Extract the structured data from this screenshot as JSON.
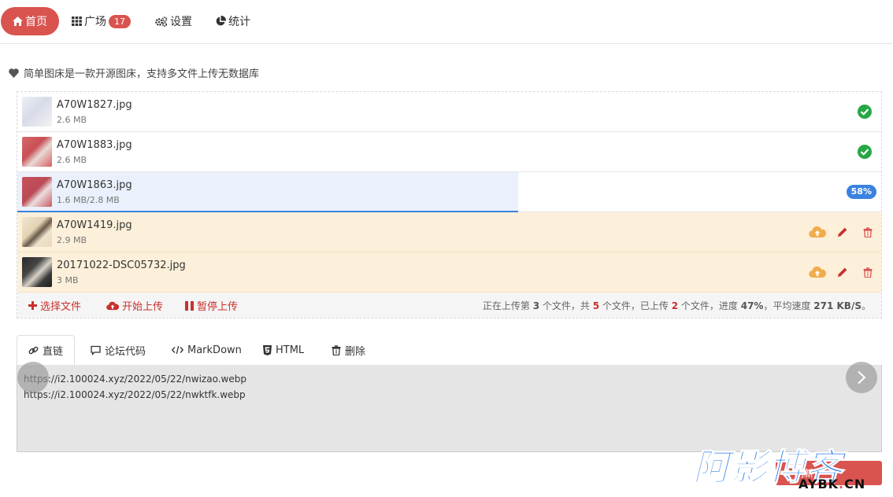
{
  "nav": {
    "home": "首页",
    "square": "广场",
    "square_badge": "17",
    "settings": "设置",
    "stats": "统计"
  },
  "description": "简单图床是一款开源图床，支持多文件上传无数据库",
  "files": [
    {
      "name": "A70W1827.jpg",
      "size": "2.6 MB",
      "state": "done"
    },
    {
      "name": "A70W1883.jpg",
      "size": "2.6 MB",
      "state": "done"
    },
    {
      "name": "A70W1863.jpg",
      "size": "1.6 MB/2.8 MB",
      "state": "uploading",
      "progress_label": "58%",
      "progress": 0.58
    },
    {
      "name": "A70W1419.jpg",
      "size": "2.9 MB",
      "state": "pending"
    },
    {
      "name": "20171022-DSC05732.jpg",
      "size": "3 MB",
      "state": "pending"
    }
  ],
  "toolbar": {
    "select": "选择文件",
    "start": "开始上传",
    "pause": "暂停上传",
    "stats": {
      "p1": "正在上传第 ",
      "current": "3",
      "p2": " 个文件，共 ",
      "total": "5",
      "p3": " 个文件，已上传 ",
      "uploaded": "2",
      "p4": " 个文件，进度 ",
      "percent": "47%",
      "p5": "，平均速度 ",
      "speed": "271 KB/S",
      "p6": "。"
    }
  },
  "tabs": [
    {
      "label": "直链"
    },
    {
      "label": "论坛代码"
    },
    {
      "label": "MarkDown"
    },
    {
      "label": "HTML"
    },
    {
      "label": "删除"
    }
  ],
  "links": [
    "https://i2.100024.xyz/2022/05/22/nwizao.webp",
    "https://i2.100024.xyz/2022/05/22/nwktfk.webp"
  ],
  "refresh_label": "刷新",
  "watermark": {
    "big": "阿影博客",
    "small_a": "AYBK",
    "small_dot": ".",
    "small_b": "CN"
  },
  "colors": {
    "accent": "#d9534f",
    "progress": "#3b82e0",
    "success": "#28a745",
    "warning": "#f0ad4e",
    "pending_bg": "#fdf0da"
  }
}
